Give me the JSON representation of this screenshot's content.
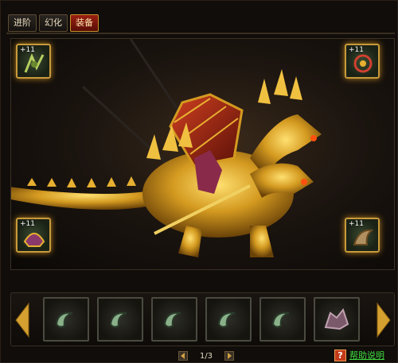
{
  "tabs": [
    {
      "label": "进阶"
    },
    {
      "label": "幻化"
    },
    {
      "label": "装备",
      "active": true
    }
  ],
  "equip_slots": [
    {
      "level": "+11",
      "icon": "talisman-icon"
    },
    {
      "level": "+11",
      "icon": "orb-icon"
    },
    {
      "level": "+11",
      "icon": "helmet-icon"
    },
    {
      "level": "+11",
      "icon": "claw-icon"
    }
  ],
  "items": [
    {
      "icon": "horn-icon"
    },
    {
      "icon": "horn-icon"
    },
    {
      "icon": "horn-icon"
    },
    {
      "icon": "horn-icon"
    },
    {
      "icon": "horn-icon"
    },
    {
      "icon": "dragon-armor-icon"
    }
  ],
  "pager": {
    "text": "1/3"
  },
  "help": {
    "q": "?",
    "label": "帮助说明"
  },
  "colors": {
    "accent_gold": "#c89a3a",
    "active_tab": "#9a1f12",
    "help_text": "#3fdc3f"
  }
}
